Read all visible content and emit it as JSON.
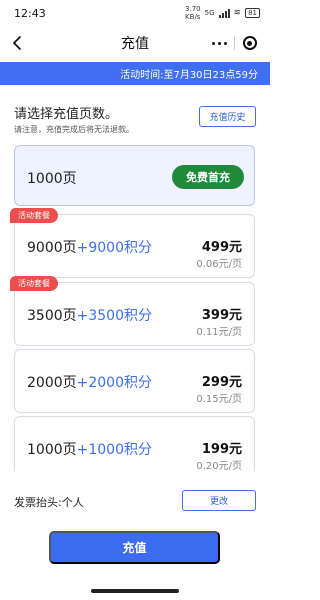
{
  "status_bar": {
    "time": "12:43",
    "speed": "3.70",
    "speed_unit": "KB/s",
    "network": "5G",
    "battery": "81"
  },
  "nav": {
    "title": "充值"
  },
  "banner": {
    "text": "活动时间:至7月30日23点59分"
  },
  "prompt": {
    "title": "请选择充值页数。",
    "notice": "请注意，充值完成后将无法退款。",
    "history_label": "充值历史"
  },
  "first_option": {
    "pages": "1000页",
    "badge": "免费首充"
  },
  "packages": [
    {
      "tag": "活动套餐",
      "pages": "9000页",
      "points": "+9000积分",
      "price": "499元",
      "unit_price": "0.06元/页"
    },
    {
      "tag": "活动套餐",
      "pages": "3500页",
      "points": "+3500积分",
      "price": "399元",
      "unit_price": "0.11元/页"
    },
    {
      "tag": "",
      "pages": "2000页",
      "points": "+2000积分",
      "price": "299元",
      "unit_price": "0.15元/页"
    },
    {
      "tag": "",
      "pages": "1000页",
      "points": "+1000积分",
      "price": "199元",
      "unit_price": "0.20元/页"
    }
  ],
  "invoice": {
    "label": "发票抬头:个人",
    "change_label": "更改"
  },
  "recharge_label": "充值",
  "colors": {
    "accent": "#3f6ff0",
    "free_badge": "#1e8a3a",
    "tag_red": "#ec4e4e",
    "points_blue": "#3f6ff0"
  }
}
